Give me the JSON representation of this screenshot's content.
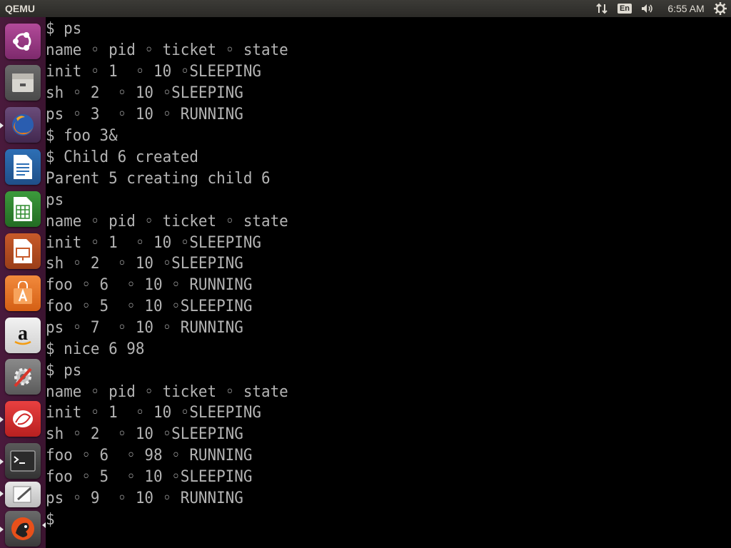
{
  "topbar": {
    "app_title": "QEMU",
    "keyboard_layout": "En",
    "clock": "6:55 AM",
    "icons": [
      "network-arrows-icon",
      "keyboard-layout-icon",
      "sound-volume-icon",
      "settings-gear-icon"
    ]
  },
  "launcher": {
    "items": [
      {
        "name": "ubuntu-dash-icon"
      },
      {
        "name": "files-icon"
      },
      {
        "name": "firefox-icon"
      },
      {
        "name": "libreoffice-writer-icon"
      },
      {
        "name": "libreoffice-calc-icon"
      },
      {
        "name": "libreoffice-impress-icon"
      },
      {
        "name": "software-center-icon"
      },
      {
        "name": "amazon-icon"
      },
      {
        "name": "system-settings-icon"
      },
      {
        "name": "document-viewer-icon"
      },
      {
        "name": "terminal-icon"
      },
      {
        "name": "text-editor-icon"
      },
      {
        "name": "qemu-icon"
      }
    ]
  },
  "terminal": {
    "lines": [
      "$ ps",
      "name ◦ pid ◦ ticket ◦ state",
      "init ◦ 1  ◦ 10 ◦SLEEPING",
      "sh ◦ 2  ◦ 10 ◦SLEEPING",
      "ps ◦ 3  ◦ 10 ◦ RUNNING",
      "$ foo 3&",
      "$ Child 6 created",
      "Parent 5 creating child 6",
      "ps",
      "name ◦ pid ◦ ticket ◦ state",
      "init ◦ 1  ◦ 10 ◦SLEEPING",
      "sh ◦ 2  ◦ 10 ◦SLEEPING",
      "foo ◦ 6  ◦ 10 ◦ RUNNING",
      "foo ◦ 5  ◦ 10 ◦SLEEPING",
      "ps ◦ 7  ◦ 10 ◦ RUNNING",
      "$ nice 6 98",
      "$ ps",
      "name ◦ pid ◦ ticket ◦ state",
      "init ◦ 1  ◦ 10 ◦SLEEPING",
      "sh ◦ 2  ◦ 10 ◦SLEEPING",
      "foo ◦ 6  ◦ 98 ◦ RUNNING",
      "foo ◦ 5  ◦ 10 ◦SLEEPING",
      "ps ◦ 9  ◦ 10 ◦ RUNNING",
      "$"
    ]
  }
}
